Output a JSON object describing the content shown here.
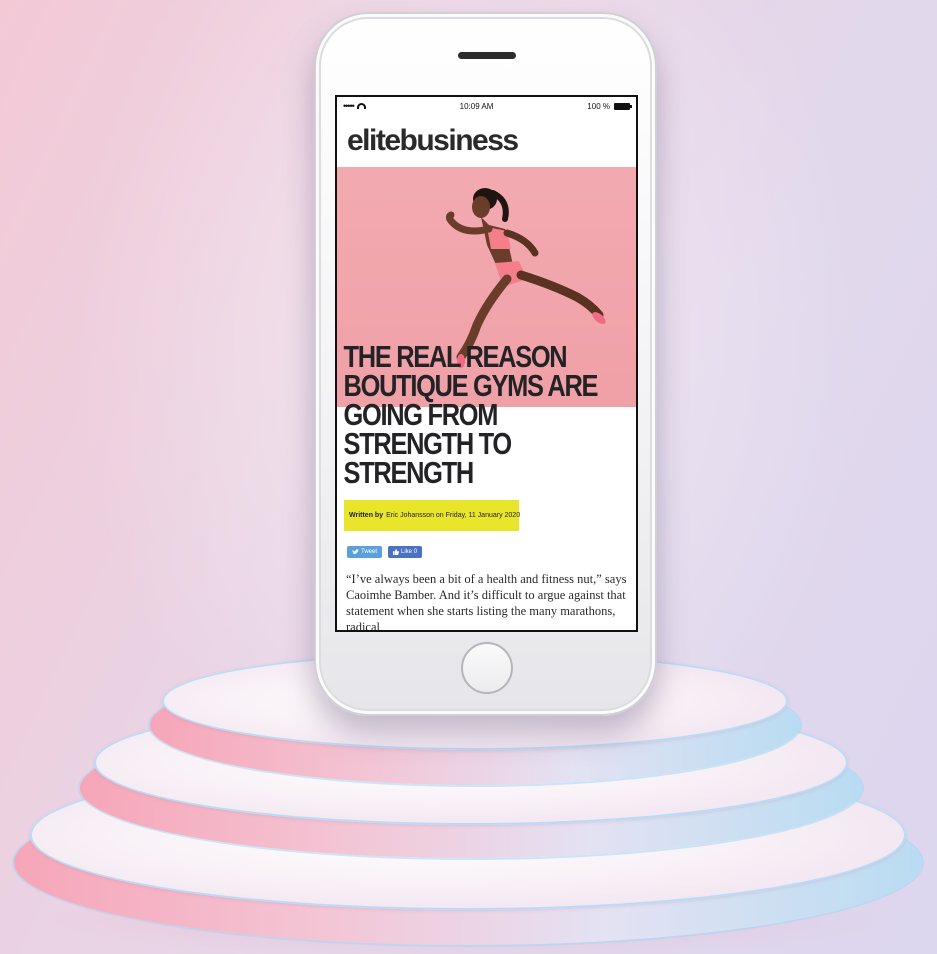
{
  "status_bar": {
    "signal_dots": "•••••",
    "time": "10:09 AM",
    "battery": "100 %"
  },
  "site": {
    "logo": "elitebusiness"
  },
  "article": {
    "headline": "THE REAL REASON BOUTIQUE GYMS ARE GOING FROM STRENGTH TO STRENGTH",
    "byline_label": "Written by",
    "byline_text": "Eric Johansson on Friday, 11 January 2020",
    "body": "“I’ve always been a bit of a health and fitness nut,” says Caoimhe Bamber. And it’s difficult to argue against that statement when she starts listing the many marathons, radical"
  },
  "social": {
    "tweet_label": "Tweet",
    "like_label": "Like 0"
  },
  "icons": {
    "wifi": "wifi-icon",
    "battery": "battery-icon",
    "twitter": "twitter-bird-icon",
    "facebook": "thumbs-up-icon"
  },
  "colors": {
    "hero_pink": "#f0a0a7",
    "byline_yellow": "#e9e52a",
    "tweet_blue": "#5aa0dd",
    "like_blue": "#4a72c0"
  }
}
